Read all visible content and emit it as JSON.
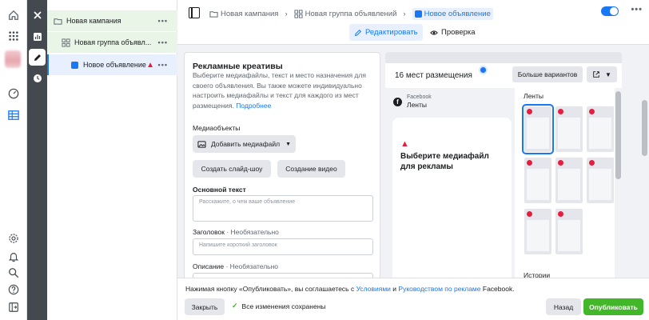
{
  "breadcrumb": {
    "campaign": "Новая кампания",
    "adset": "Новая группа объявлений",
    "ad": "Новое объявление"
  },
  "tabs": {
    "edit": "Редактировать",
    "review": "Проверка"
  },
  "tree": {
    "campaign": "Новая кампания",
    "adset": "Новая группа объявл...",
    "ad": "Новое объявление",
    "more": "•••",
    "warning": "▲"
  },
  "editor": {
    "title": "Рекламные креативы",
    "description": "Выберите медиафайлы, текст и место назначения для своего объявления. Вы также можете индивидуально настроить медиафайлы и текст для каждого из мест размещения.",
    "more_link": "Подробнее",
    "media_label": "Медиаобъекты",
    "add_media": "Добавить медиафайл",
    "slideshow": "Создать слайд-шоу",
    "video": "Создание видео",
    "primary_text_label": "Основной текст",
    "primary_text_placeholder": "Расскажите, о чем ваше объявление",
    "headline_label": "Заголовок",
    "optional": " · Необязательно",
    "headline_placeholder": "Напишите короткий заголовок",
    "description_label": "Описание"
  },
  "preview": {
    "placements": "16 мест размещения",
    "more_variants": "Больше вариантов",
    "platform": "Facebook",
    "placement": "Ленты",
    "empty_message": "Выберите медиафайл для рекламы",
    "feeds_title": "Ленты",
    "stories_title": "Истории",
    "warning": "▲"
  },
  "footer": {
    "agreement_prefix": "Нажимая кнопку «Опубликовать», вы соглашаетесь с ",
    "agreement_terms": "Условиями",
    "agreement_mid": " и ",
    "agreement_guide": "Руководством по рекламе",
    "agreement_suffix": " Facebook.",
    "close": "Закрыть",
    "saved": "Все изменения сохранены",
    "saved_check": "✓",
    "back": "Назад",
    "publish": "Опубликовать"
  },
  "colors": {
    "accent": "#1877f2",
    "success": "#42b72a",
    "error": "#e41e3f"
  }
}
